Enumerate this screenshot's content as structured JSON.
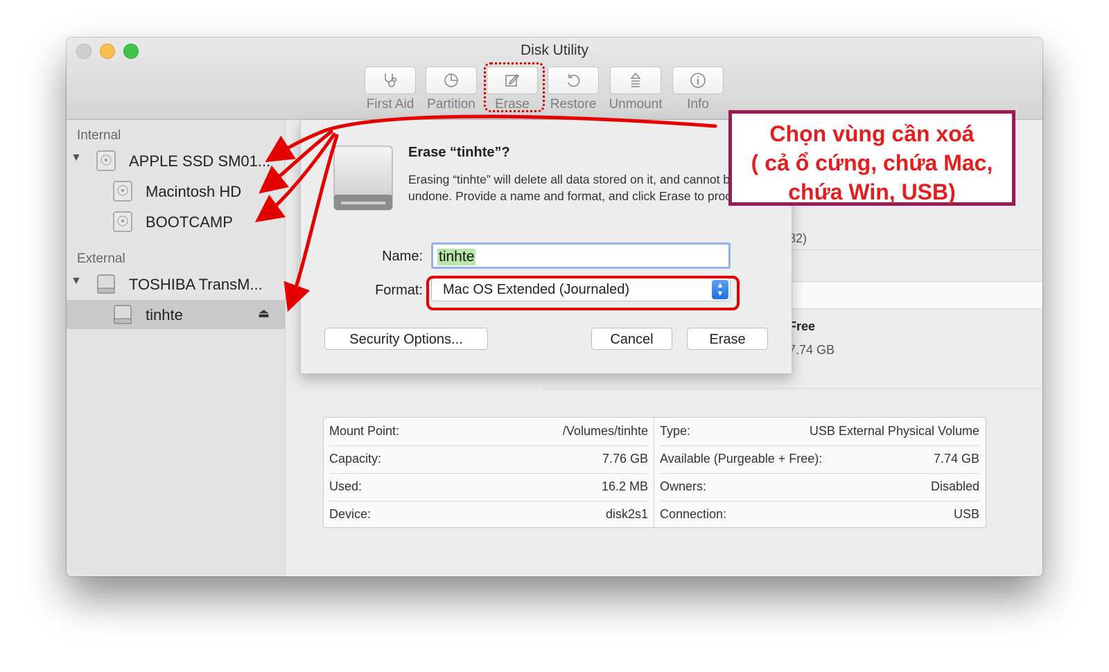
{
  "window": {
    "title": "Disk Utility"
  },
  "toolbar": {
    "first_aid": "First Aid",
    "partition": "Partition",
    "erase": "Erase",
    "restore": "Restore",
    "unmount": "Unmount",
    "info": "Info"
  },
  "sidebar": {
    "internal_heading": "Internal",
    "external_heading": "External",
    "internal_items": [
      {
        "label": "APPLE SSD SM01...",
        "icon": "internal-disk-icon"
      },
      {
        "label": "Macintosh HD",
        "icon": "volume-icon"
      },
      {
        "label": "BOOTCAMP",
        "icon": "volume-icon"
      }
    ],
    "external_items": [
      {
        "label": "TOSHIBA TransM...",
        "icon": "external-disk-icon"
      },
      {
        "label": "tinhte",
        "icon": "external-volume-icon",
        "selected": true
      }
    ]
  },
  "dialog": {
    "title": "Erase “tinhte”?",
    "body": "Erasing “tinhte” will delete all data stored on it, and cannot be undone. Provide a name and format, and click Erase to proceed.",
    "name_label": "Name:",
    "name_value": "tinhte",
    "format_label": "Format:",
    "format_value": "Mac OS Extended (Journaled)",
    "security_button": "Security Options...",
    "cancel_button": "Cancel",
    "erase_button": "Erase"
  },
  "main": {
    "fragment_32": "32)",
    "free_label": "Free",
    "free_value": "7.74 GB"
  },
  "info_table": {
    "left": [
      {
        "key": "Mount Point:",
        "value": "/Volumes/tinhte"
      },
      {
        "key": "Capacity:",
        "value": "7.76 GB"
      },
      {
        "key": "Used:",
        "value": "16.2 MB"
      },
      {
        "key": "Device:",
        "value": "disk2s1"
      }
    ],
    "right": [
      {
        "key": "Type:",
        "value": "USB External Physical Volume"
      },
      {
        "key": "Available (Purgeable + Free):",
        "value": "7.74 GB"
      },
      {
        "key": "Owners:",
        "value": "Disabled"
      },
      {
        "key": "Connection:",
        "value": "USB"
      }
    ]
  },
  "annotation": {
    "line1": "Chọn vùng cần xoá",
    "line2": "( cả ổ cứng, chứa Mac,",
    "line3": "chứa Win, USB)",
    "color": "#e41e1e",
    "border_color": "#9b1a52"
  }
}
